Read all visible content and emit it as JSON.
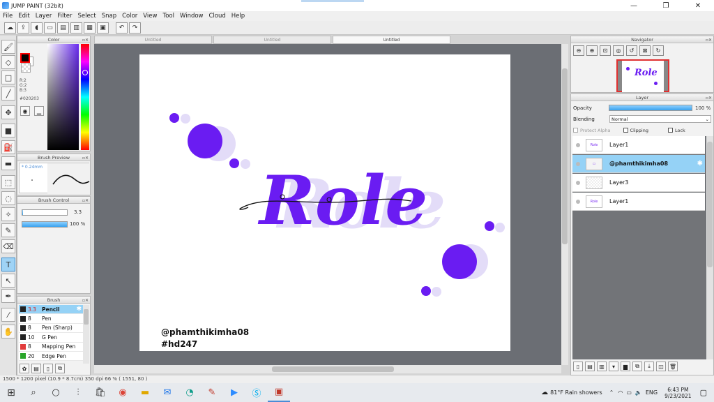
{
  "window": {
    "title": "JUMP PAINT (32bit)",
    "minimize": "—",
    "restore": "❐",
    "close": "✕"
  },
  "menu": [
    "File",
    "Edit",
    "Layer",
    "Filter",
    "Select",
    "Snap",
    "Color",
    "View",
    "Tool",
    "Window",
    "Cloud",
    "Help"
  ],
  "doc_tabs": [
    "Untitled",
    "Untitled",
    "Untitled"
  ],
  "color_panel": {
    "title": "Color",
    "rgb": [
      "R:2",
      "G:2",
      "B:3"
    ],
    "hex": "#020203"
  },
  "brush_preview": {
    "title": "Brush Preview",
    "size_label": "* 0.24mm"
  },
  "brush_control": {
    "title": "Brush Control",
    "size_value": "3.3",
    "opacity_value": "100 %",
    "size_fraction": 0.0,
    "opacity_percent": 100
  },
  "brush_panel": {
    "title": "Brush",
    "items": [
      {
        "size": "3.3",
        "name": "Pencil",
        "color": "#222222",
        "selected": true
      },
      {
        "size": "8",
        "name": "Pen",
        "color": "#222222"
      },
      {
        "size": "8",
        "name": "Pen (Sharp)",
        "color": "#222222"
      },
      {
        "size": "10",
        "name": "G Pen",
        "color": "#222222"
      },
      {
        "size": "8",
        "name": "Mapping Pen",
        "color": "#e23b3b"
      },
      {
        "size": "20",
        "name": "Edge Pen",
        "color": "#2aa52a"
      }
    ]
  },
  "navigator": {
    "title": "Navigator",
    "thumb_text": "Role"
  },
  "layer_panel": {
    "title": "Layer",
    "opacity_label": "Opacity",
    "opacity_value": "100 %",
    "opacity_percent": 100,
    "blending_label": "Blending",
    "blending_value": "Normal",
    "protect_alpha": "Protect Alpha",
    "clipping": "Clipping",
    "lock": "Lock",
    "layers": [
      {
        "name": "Layer1",
        "thumb": "Role",
        "selected": false
      },
      {
        "name": "@phamthikimha08",
        "thumb": "",
        "selected": true
      },
      {
        "name": "Layer3",
        "thumb": "",
        "selected": false
      },
      {
        "name": "Layer1",
        "thumb": "Role",
        "selected": false
      }
    ]
  },
  "artwork": {
    "title_text": "Role",
    "credit": "@phamthikimha08",
    "tag": "#hd247",
    "primary_color": "#6a1cf2",
    "shadow_color": "#e3dcf8"
  },
  "status": {
    "text": "1500 * 1200 pixel  (10.9 * 8.7cm)  350 dpi  66 %  ( 1551, 80 )"
  },
  "taskbar": {
    "weather": "81°F  Rain showers",
    "lang": "ENG",
    "time": "6:43 PM",
    "date": "9/23/2021"
  }
}
